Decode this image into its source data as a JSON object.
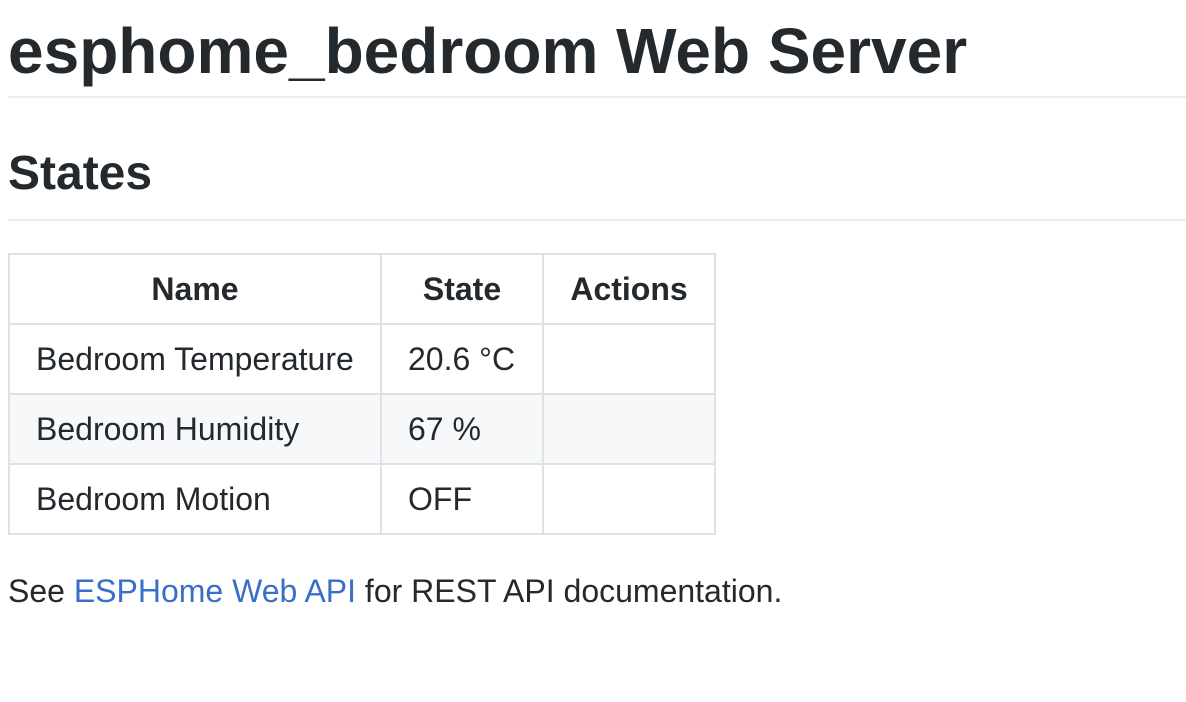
{
  "page": {
    "title": "esphome_bedroom Web Server",
    "states_heading": "States"
  },
  "table": {
    "headers": {
      "name": "Name",
      "state": "State",
      "actions": "Actions"
    },
    "rows": [
      {
        "name": "Bedroom Temperature",
        "state": "20.6 °C",
        "actions": ""
      },
      {
        "name": "Bedroom Humidity",
        "state": "67 %",
        "actions": ""
      },
      {
        "name": "Bedroom Motion",
        "state": "OFF",
        "actions": ""
      }
    ]
  },
  "footer": {
    "prefix": "See ",
    "link_text": "ESPHome Web API",
    "suffix": " for REST API documentation."
  },
  "colors": {
    "text": "#24292e",
    "link": "#3a6fc8",
    "border": "#dfe2e5",
    "alt_row": "#f6f8fa"
  }
}
